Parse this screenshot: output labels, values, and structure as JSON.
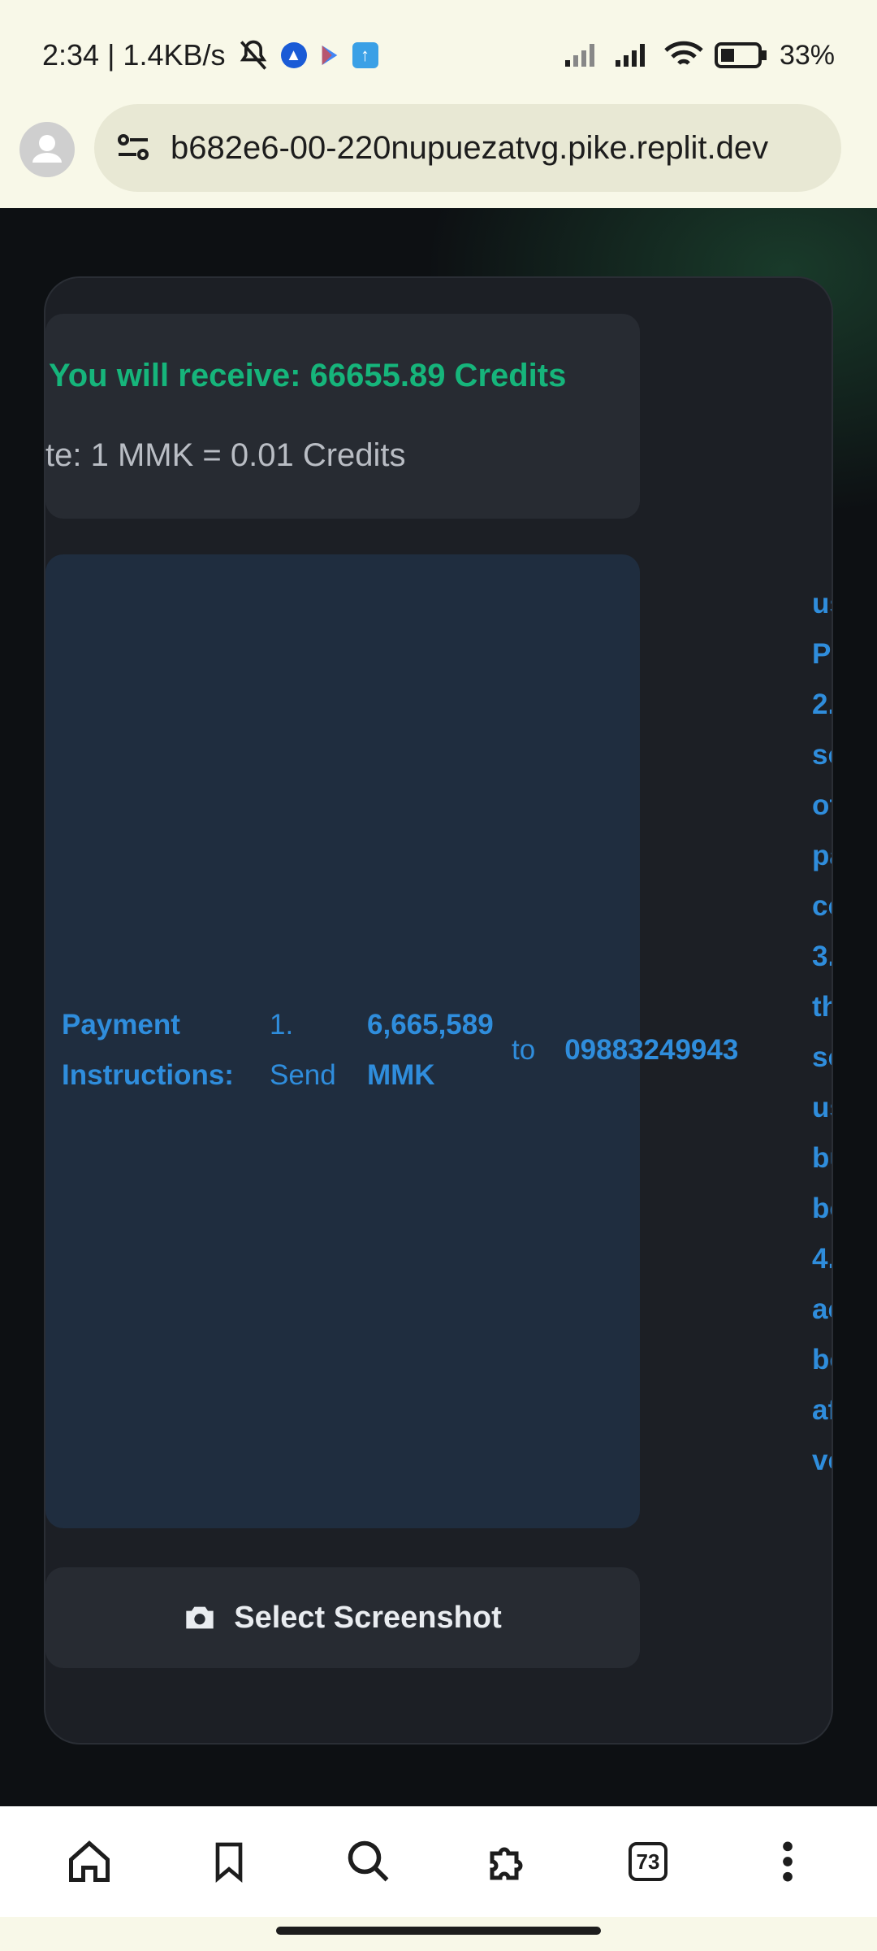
{
  "status_bar": {
    "time_speed": "2:34 | 1.4KB/s",
    "battery": "33%",
    "icons": [
      "mute-icon",
      "app-a-icon",
      "play-store-icon",
      "upload-app-icon",
      "signal-icon",
      "signal-icon",
      "wifi-icon",
      "battery-icon"
    ]
  },
  "browser": {
    "url": "b682e6-00-220nupuezatvg.pike.replit.dev",
    "tab_count": "73"
  },
  "page": {
    "receive_text": "You will receive: 66655.89 Credits",
    "rate_text": "te: 1 MMK = 0.01 Credits",
    "payment": {
      "title": "Payment Instructions:",
      "step1": "1. Send",
      "amount": "6,665,589 MMK",
      "to": "to",
      "phone": "09883249943",
      "overflow_lines": [
        "us",
        "Pa",
        "2.",
        "so",
        "of",
        "pa",
        "co",
        "3.",
        "th",
        "so",
        "us",
        "bu",
        "be",
        "4.",
        "ac",
        "be",
        "af",
        "ve"
      ]
    },
    "select_button": "Select Screenshot"
  },
  "colors": {
    "accent_green": "#16b57b",
    "accent_blue": "#2f8ddc",
    "card_bg": "#1c1f25"
  }
}
